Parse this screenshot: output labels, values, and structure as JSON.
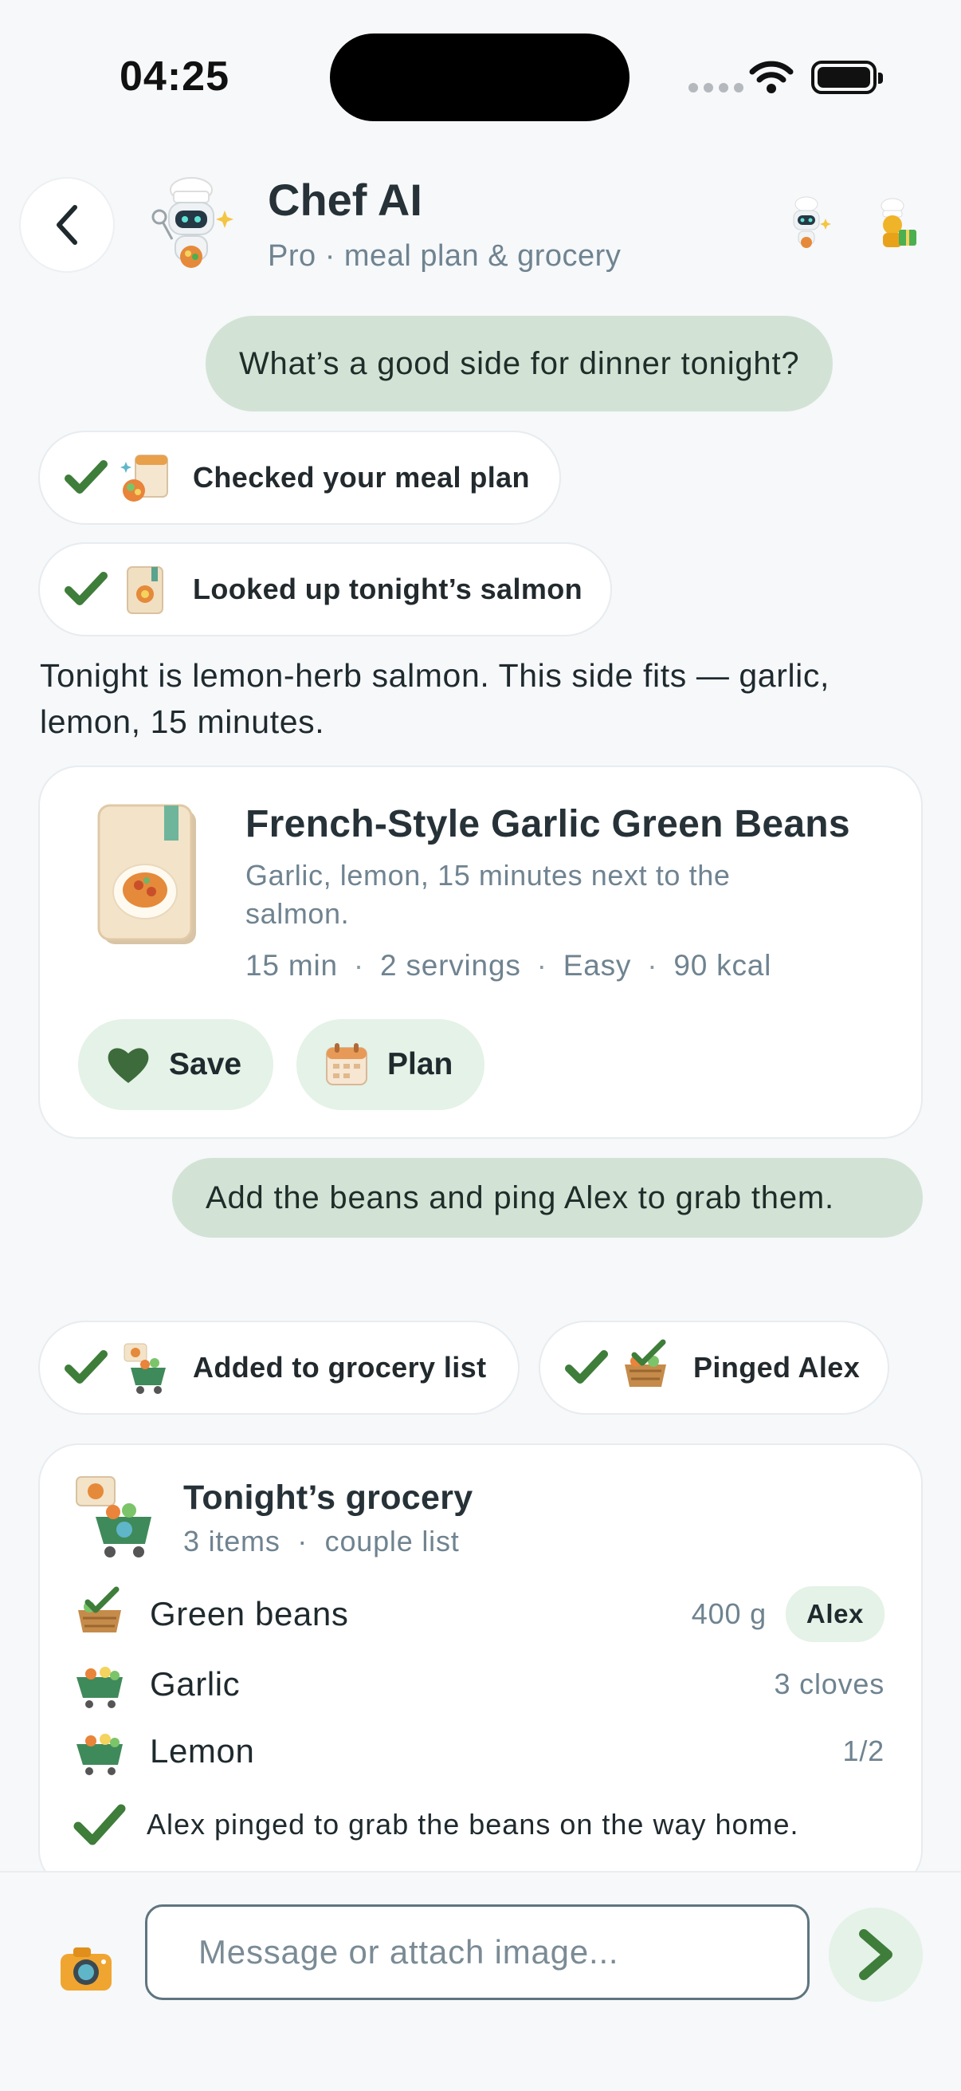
{
  "status_bar": {
    "time": "04:25"
  },
  "header": {
    "title": "Chef AI",
    "subtitle": "Pro · meal plan & grocery",
    "back_icon": "chevron-left-icon",
    "avatar_icon": "robot-chef-icon"
  },
  "messages": {
    "user1": "What’s a good side for dinner tonight?",
    "tool_meal_plan": "Checked your meal plan",
    "tool_salmon": "Looked up tonight’s salmon",
    "assistant1": "Tonight is lemon-herb salmon. This side fits — garlic, lemon, 15 minutes.",
    "user2": "Add the beans and ping Alex to grab them.",
    "tool_grocery": "Added to grocery list",
    "tool_ping": "Pinged Alex"
  },
  "recipe": {
    "title": "French-Style Garlic Green Beans",
    "description": "Garlic, lemon, 15 minutes next to the salmon.",
    "time": "15 min",
    "servings": "2 servings",
    "difficulty": "Easy",
    "calories": "90 kcal",
    "save_label": "Save",
    "plan_label": "Plan"
  },
  "grocery": {
    "title": "Tonight’s grocery",
    "count": "3 items",
    "list_name": "couple list",
    "items": [
      {
        "name": "Green beans",
        "qty": "400 g",
        "assignee": "Alex"
      },
      {
        "name": "Garlic",
        "qty": "3 cloves"
      },
      {
        "name": "Lemon",
        "qty": "1/2"
      }
    ],
    "note": "Alex pinged to grab the beans on the way home."
  },
  "composer": {
    "placeholder": "Message or attach image..."
  },
  "colors": {
    "accent_green": "#3f7d3a",
    "bubble_user": "#d2e3d5",
    "pill_bg": "#e4f2e7"
  }
}
